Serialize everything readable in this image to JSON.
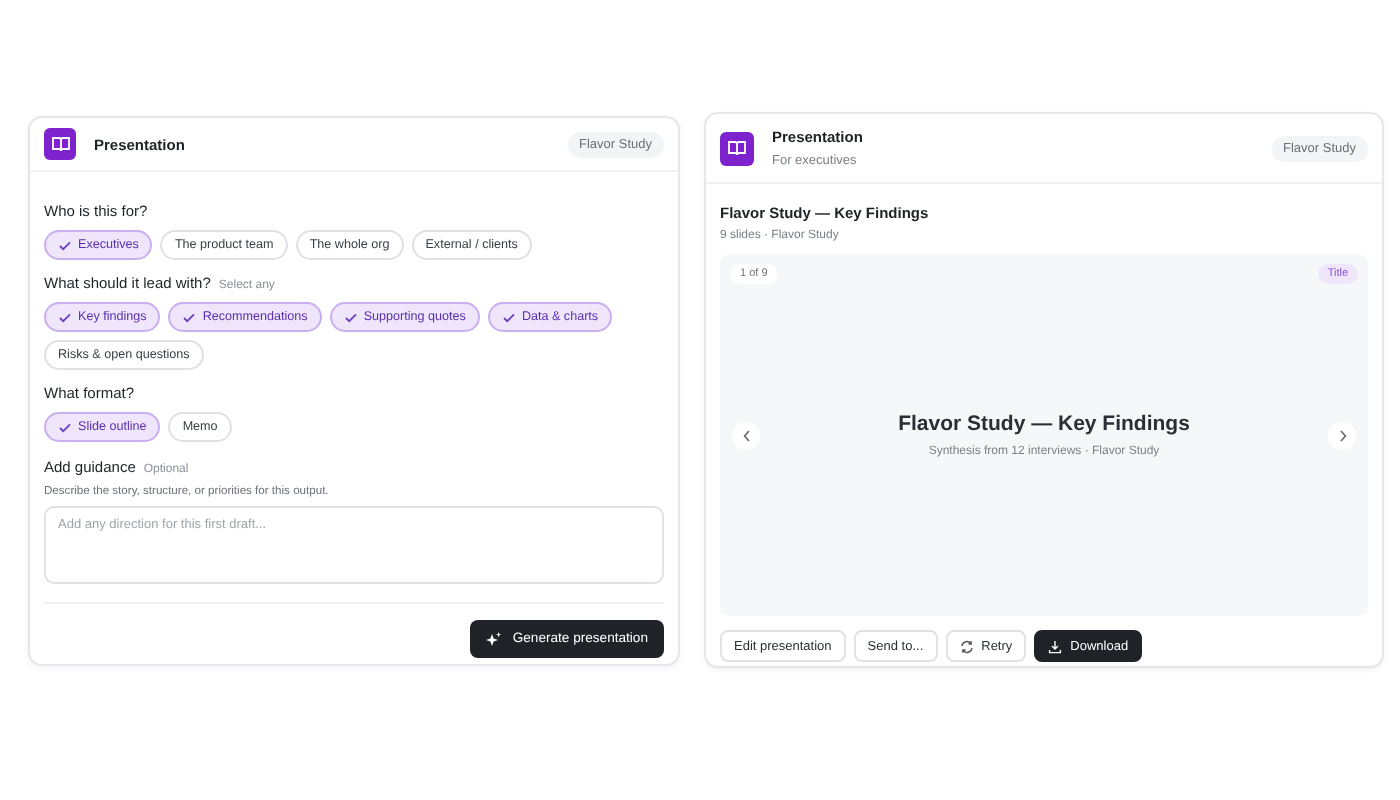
{
  "setup_card": {
    "title": "Presentation",
    "tag": "Flavor Study",
    "questions": [
      {
        "label": "Who is this for?",
        "options": [
          {
            "label": "Executives",
            "selected": true
          },
          {
            "label": "The product team",
            "selected": false
          },
          {
            "label": "The whole org",
            "selected": false
          },
          {
            "label": "External / clients",
            "selected": false
          }
        ]
      },
      {
        "label": "What should it lead with?",
        "hint": "Select any",
        "options": [
          {
            "label": "Key findings",
            "selected": true
          },
          {
            "label": "Recommendations",
            "selected": true
          },
          {
            "label": "Supporting quotes",
            "selected": true
          },
          {
            "label": "Data & charts",
            "selected": true
          },
          {
            "label": "Risks & open questions",
            "selected": false
          }
        ]
      },
      {
        "label": "What format?",
        "options": [
          {
            "label": "Slide outline",
            "selected": true
          },
          {
            "label": "Memo",
            "selected": false
          }
        ]
      }
    ],
    "guidance": {
      "label": "Add guidance",
      "hint": "Optional",
      "description": "Describe the story, structure, or priorities for this output.",
      "placeholder": "Add any direction for this first draft..."
    },
    "generate_button": "Generate presentation"
  },
  "result_card": {
    "title": "Presentation",
    "subtitle": "For executives",
    "tag": "Flavor Study",
    "deck_title": "Flavor Study — Key Findings",
    "deck_meta": "9 slides · Flavor Study",
    "slide": {
      "counter": "1 of 9",
      "type_tag": "Title",
      "title": "Flavor Study — Key Findings",
      "subtitle": "Synthesis from 12 interviews · Flavor Study"
    },
    "actions": [
      {
        "label": "Edit presentation",
        "kind": "plain"
      },
      {
        "label": "Send to...",
        "kind": "plain"
      },
      {
        "label": "Retry",
        "kind": "retry"
      },
      {
        "label": "Download",
        "kind": "download"
      }
    ]
  }
}
